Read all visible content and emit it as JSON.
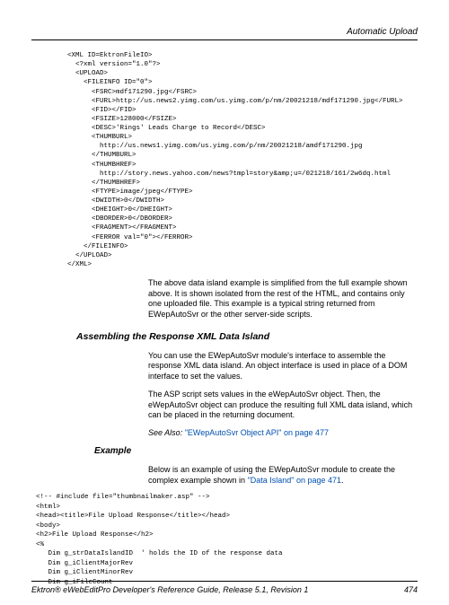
{
  "header": {
    "title": "Automatic Upload"
  },
  "code1": "<XML ID=EktronFileIO>\n  <?xml version=\"1.0\"?>\n  <UPLOAD>\n    <FILEINFO ID=\"0\">\n      <FSRC>mdf171290.jpg</FSRC>\n      <FURL>http://us.news2.yimg.com/us.yimg.com/p/nm/20021218/mdf171290.jpg</FURL>\n      <FID></FID>\n      <FSIZE>128000</FSIZE>\n      <DESC>'Rings' Leads Charge to Record</DESC>\n      <THUMBURL>\n        http://us.news1.yimg.com/us.yimg.com/p/nm/20021218/amdf171290.jpg\n      </THUMBURL>\n      <THUMBHREF>\n        http://story.news.yahoo.com/news?tmpl=story&amp;u=/021218/161/2w6dq.html\n      </THUMBHREF>\n      <FTYPE>image/jpeg</FTYPE>\n      <DWIDTH>0</DWIDTH>\n      <DHEIGHT>0</DHEIGHT>\n      <DBORDER>0</DBORDER>\n      <FRAGMENT></FRAGMENT>\n      <FERROR val=\"0\"></FERROR>\n    </FILEINFO>\n  </UPLOAD>\n</XML>",
  "para1": "The above data island example is simplified from the full example shown above. It is shown isolated from the rest of the HTML, and contains only one uploaded file. This example is a typical string returned from EWepAutoSvr or the other server-side scripts.",
  "heading1": "Assembling the Response XML Data Island",
  "para2": "You can use the EWepAutoSvr module's interface to assemble the response XML data island. An object interface is used in place of a DOM interface to set the values.",
  "para3": "The ASP script sets values in the eWepAutoSvr object. Then, the eWepAutoSvr object can produce the resulting full XML data island, which can be placed in the returning document.",
  "seealso": {
    "label": "See Also: ",
    "link": "\"EWepAutoSvr Object API\" on page 477"
  },
  "heading2": "Example",
  "para4_pre": "Below is an example of using the EWepAutoSvr module to create the complex example shown in ",
  "para4_link": "\"Data Island\" on page 471",
  "para4_post": ".",
  "code2": "<!-- #include file=\"thumbnailmaker.asp\" -->\n<html>\n<head><title>File Upload Response</title></head>\n<body>\n<h2>File Upload Response</h2>\n<%\n   Dim g_strDataIslandID  ' holds the ID of the response data\n   Dim g_iClientMajorRev\n   Dim g_iClientMinorRev\n   Dim g_iFileCount",
  "footer": {
    "left": "Ektron® eWebEditPro Developer's Reference Guide, Release 5.1, Revision 1",
    "right": "474"
  }
}
